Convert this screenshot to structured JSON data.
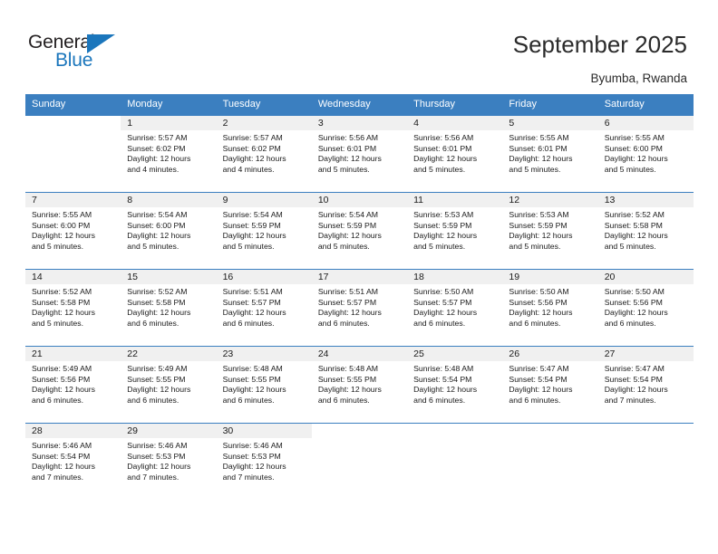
{
  "brand": {
    "name_part1": "General",
    "name_part2": "Blue",
    "logo_icon": "triangle-flag-icon",
    "accent_color": "#1b76bc"
  },
  "header": {
    "title": "September 2025",
    "location": "Byumba, Rwanda"
  },
  "calendar": {
    "header_bg_color": "#3b7fc0",
    "daynum_band_color": "#f0f0f0",
    "weekday_headers": [
      "Sunday",
      "Monday",
      "Tuesday",
      "Wednesday",
      "Thursday",
      "Friday",
      "Saturday"
    ],
    "weeks": [
      [
        {
          "day": "",
          "lines": []
        },
        {
          "day": "1",
          "lines": [
            "Sunrise: 5:57 AM",
            "Sunset: 6:02 PM",
            "Daylight: 12 hours",
            "and 4 minutes."
          ]
        },
        {
          "day": "2",
          "lines": [
            "Sunrise: 5:57 AM",
            "Sunset: 6:02 PM",
            "Daylight: 12 hours",
            "and 4 minutes."
          ]
        },
        {
          "day": "3",
          "lines": [
            "Sunrise: 5:56 AM",
            "Sunset: 6:01 PM",
            "Daylight: 12 hours",
            "and 5 minutes."
          ]
        },
        {
          "day": "4",
          "lines": [
            "Sunrise: 5:56 AM",
            "Sunset: 6:01 PM",
            "Daylight: 12 hours",
            "and 5 minutes."
          ]
        },
        {
          "day": "5",
          "lines": [
            "Sunrise: 5:55 AM",
            "Sunset: 6:01 PM",
            "Daylight: 12 hours",
            "and 5 minutes."
          ]
        },
        {
          "day": "6",
          "lines": [
            "Sunrise: 5:55 AM",
            "Sunset: 6:00 PM",
            "Daylight: 12 hours",
            "and 5 minutes."
          ]
        }
      ],
      [
        {
          "day": "7",
          "lines": [
            "Sunrise: 5:55 AM",
            "Sunset: 6:00 PM",
            "Daylight: 12 hours",
            "and 5 minutes."
          ]
        },
        {
          "day": "8",
          "lines": [
            "Sunrise: 5:54 AM",
            "Sunset: 6:00 PM",
            "Daylight: 12 hours",
            "and 5 minutes."
          ]
        },
        {
          "day": "9",
          "lines": [
            "Sunrise: 5:54 AM",
            "Sunset: 5:59 PM",
            "Daylight: 12 hours",
            "and 5 minutes."
          ]
        },
        {
          "day": "10",
          "lines": [
            "Sunrise: 5:54 AM",
            "Sunset: 5:59 PM",
            "Daylight: 12 hours",
            "and 5 minutes."
          ]
        },
        {
          "day": "11",
          "lines": [
            "Sunrise: 5:53 AM",
            "Sunset: 5:59 PM",
            "Daylight: 12 hours",
            "and 5 minutes."
          ]
        },
        {
          "day": "12",
          "lines": [
            "Sunrise: 5:53 AM",
            "Sunset: 5:59 PM",
            "Daylight: 12 hours",
            "and 5 minutes."
          ]
        },
        {
          "day": "13",
          "lines": [
            "Sunrise: 5:52 AM",
            "Sunset: 5:58 PM",
            "Daylight: 12 hours",
            "and 5 minutes."
          ]
        }
      ],
      [
        {
          "day": "14",
          "lines": [
            "Sunrise: 5:52 AM",
            "Sunset: 5:58 PM",
            "Daylight: 12 hours",
            "and 5 minutes."
          ]
        },
        {
          "day": "15",
          "lines": [
            "Sunrise: 5:52 AM",
            "Sunset: 5:58 PM",
            "Daylight: 12 hours",
            "and 6 minutes."
          ]
        },
        {
          "day": "16",
          "lines": [
            "Sunrise: 5:51 AM",
            "Sunset: 5:57 PM",
            "Daylight: 12 hours",
            "and 6 minutes."
          ]
        },
        {
          "day": "17",
          "lines": [
            "Sunrise: 5:51 AM",
            "Sunset: 5:57 PM",
            "Daylight: 12 hours",
            "and 6 minutes."
          ]
        },
        {
          "day": "18",
          "lines": [
            "Sunrise: 5:50 AM",
            "Sunset: 5:57 PM",
            "Daylight: 12 hours",
            "and 6 minutes."
          ]
        },
        {
          "day": "19",
          "lines": [
            "Sunrise: 5:50 AM",
            "Sunset: 5:56 PM",
            "Daylight: 12 hours",
            "and 6 minutes."
          ]
        },
        {
          "day": "20",
          "lines": [
            "Sunrise: 5:50 AM",
            "Sunset: 5:56 PM",
            "Daylight: 12 hours",
            "and 6 minutes."
          ]
        }
      ],
      [
        {
          "day": "21",
          "lines": [
            "Sunrise: 5:49 AM",
            "Sunset: 5:56 PM",
            "Daylight: 12 hours",
            "and 6 minutes."
          ]
        },
        {
          "day": "22",
          "lines": [
            "Sunrise: 5:49 AM",
            "Sunset: 5:55 PM",
            "Daylight: 12 hours",
            "and 6 minutes."
          ]
        },
        {
          "day": "23",
          "lines": [
            "Sunrise: 5:48 AM",
            "Sunset: 5:55 PM",
            "Daylight: 12 hours",
            "and 6 minutes."
          ]
        },
        {
          "day": "24",
          "lines": [
            "Sunrise: 5:48 AM",
            "Sunset: 5:55 PM",
            "Daylight: 12 hours",
            "and 6 minutes."
          ]
        },
        {
          "day": "25",
          "lines": [
            "Sunrise: 5:48 AM",
            "Sunset: 5:54 PM",
            "Daylight: 12 hours",
            "and 6 minutes."
          ]
        },
        {
          "day": "26",
          "lines": [
            "Sunrise: 5:47 AM",
            "Sunset: 5:54 PM",
            "Daylight: 12 hours",
            "and 6 minutes."
          ]
        },
        {
          "day": "27",
          "lines": [
            "Sunrise: 5:47 AM",
            "Sunset: 5:54 PM",
            "Daylight: 12 hours",
            "and 7 minutes."
          ]
        }
      ],
      [
        {
          "day": "28",
          "lines": [
            "Sunrise: 5:46 AM",
            "Sunset: 5:54 PM",
            "Daylight: 12 hours",
            "and 7 minutes."
          ]
        },
        {
          "day": "29",
          "lines": [
            "Sunrise: 5:46 AM",
            "Sunset: 5:53 PM",
            "Daylight: 12 hours",
            "and 7 minutes."
          ]
        },
        {
          "day": "30",
          "lines": [
            "Sunrise: 5:46 AM",
            "Sunset: 5:53 PM",
            "Daylight: 12 hours",
            "and 7 minutes."
          ]
        },
        {
          "day": "",
          "lines": []
        },
        {
          "day": "",
          "lines": []
        },
        {
          "day": "",
          "lines": []
        },
        {
          "day": "",
          "lines": []
        }
      ]
    ]
  }
}
